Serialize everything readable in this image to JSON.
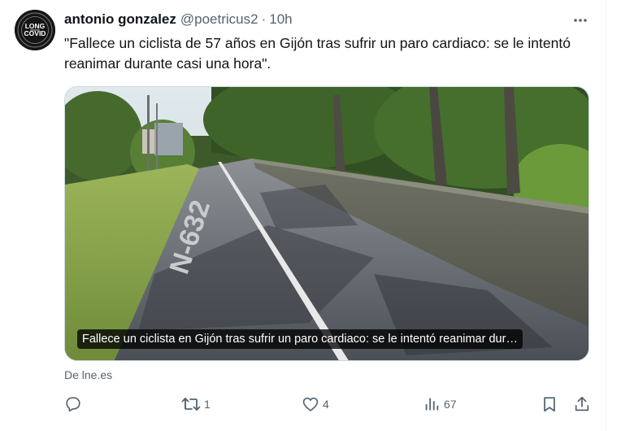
{
  "author": {
    "display_name": "antonio gonzalez",
    "handle": "@poetricus2",
    "separator": "·",
    "time": "10h",
    "avatar_text_line1": "LONG",
    "avatar_text_line2": "COVID",
    "avatar_icon": "long-covid-logo"
  },
  "tweet": {
    "text": "\"Fallece un ciclista de 57 años en Gijón tras sufrir un paro cardiaco: se le intentó reanimar durante casi una hora\"."
  },
  "link_card": {
    "title": "Fallece un ciclista en Gijón tras sufrir un paro cardiaco: se le intentó reanimar dur…",
    "road_label": "N-632",
    "source": "De lne.es"
  },
  "actions": {
    "reply_icon": "reply-icon",
    "retweet_icon": "retweet-icon",
    "retweet_count": "1",
    "like_icon": "heart-icon",
    "like_count": "4",
    "views_icon": "analytics-icon",
    "views_count": "67",
    "bookmark_icon": "bookmark-icon",
    "share_icon": "share-icon"
  },
  "colors": {
    "text_primary": "#0f1419",
    "text_secondary": "#536471",
    "border": "#cfd9de"
  }
}
